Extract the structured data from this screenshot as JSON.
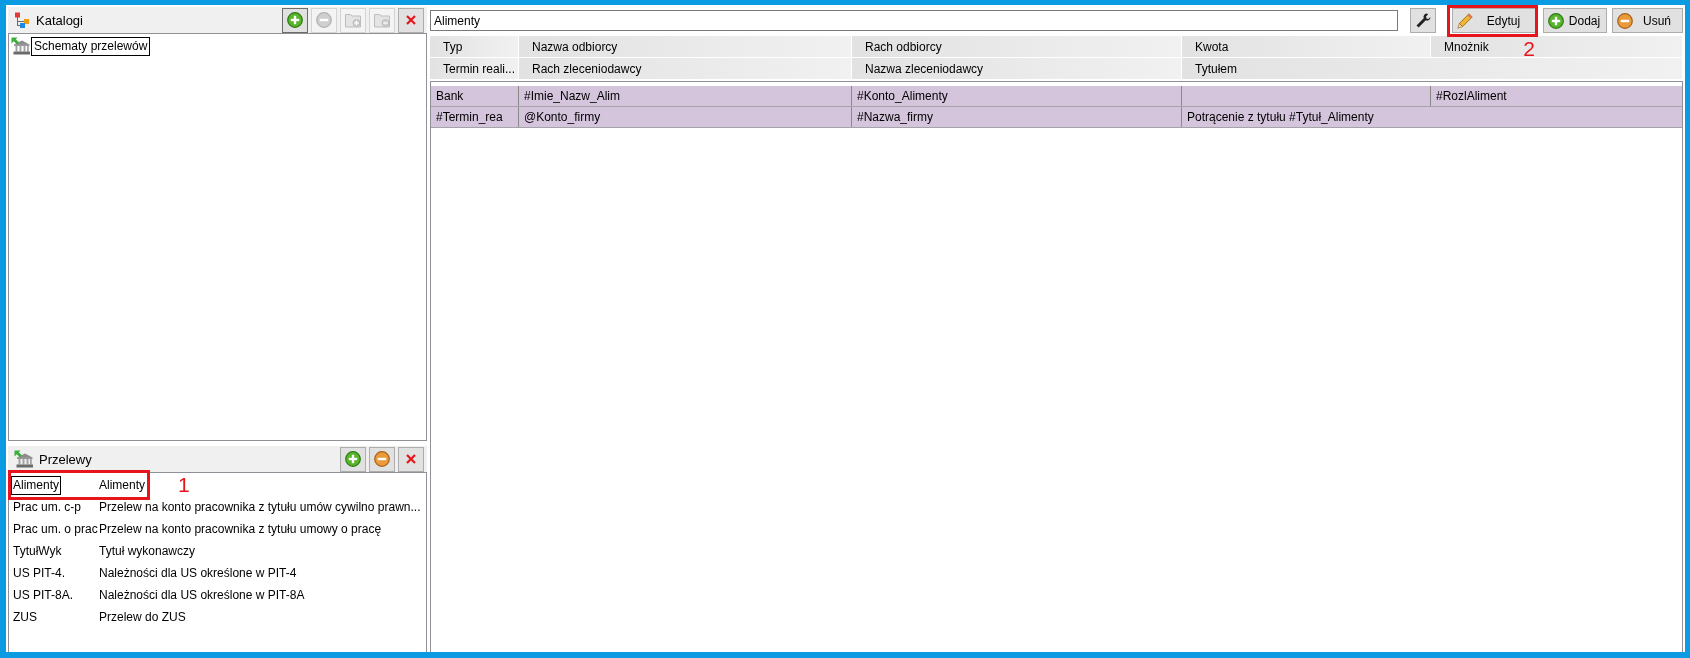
{
  "catalogs": {
    "title": "Katalogi",
    "toolbar": [
      {
        "kind": "add",
        "disabled": false,
        "focused": true
      },
      {
        "kind": "remove",
        "disabled": true,
        "focused": false
      },
      {
        "kind": "add-folder",
        "disabled": true,
        "focused": false
      },
      {
        "kind": "remove-folder",
        "disabled": true,
        "focused": false
      },
      {
        "kind": "close",
        "disabled": false,
        "focused": false
      }
    ],
    "tree": [
      {
        "label": "Schematy przelewów",
        "selected": true
      }
    ]
  },
  "transfers": {
    "title": "Przelewy",
    "toolbar": [
      {
        "kind": "add",
        "disabled": false,
        "focused": false
      },
      {
        "kind": "remove",
        "disabled": false,
        "focused": false
      },
      {
        "kind": "close",
        "disabled": false,
        "focused": false
      }
    ],
    "rows": [
      {
        "code": "Alimenty",
        "description": "Alimenty",
        "selected": true,
        "annotation": "1"
      },
      {
        "code": "Prac um. c-p",
        "description": "Przelew na konto pracownika z tytułu umów cywilno prawn...",
        "selected": false
      },
      {
        "code": "Prac um. o prac",
        "description": "Przelew na konto pracownika z tytułu umowy o pracę",
        "selected": false
      },
      {
        "code": "TytułWyk",
        "description": "Tytuł wykonawczy",
        "selected": false
      },
      {
        "code": "US PIT-4.",
        "description": "Należności dla US określone w PIT-4",
        "selected": false
      },
      {
        "code": "US PIT-8A.",
        "description": "Należności dla US określone w PIT-8A",
        "selected": false
      },
      {
        "code": "ZUS",
        "description": "Przelew do ZUS",
        "selected": false
      }
    ]
  },
  "schema": {
    "name_field": {
      "value": "Alimenty"
    },
    "toolbar": [
      {
        "kind": "settings"
      },
      {
        "kind": "edit",
        "label": "Edytuj",
        "annotation": "2"
      },
      {
        "kind": "add",
        "label": "Dodaj"
      },
      {
        "kind": "remove",
        "label": "Usuń"
      }
    ],
    "header_rows": [
      {
        "cells": [
          "Typ",
          "Nazwa odbiorcy",
          "Rach odbiorcy",
          "Kwota",
          "Mnożnik"
        ]
      },
      {
        "cells": [
          "Termin reali...",
          "Rach zleceniodawcy",
          "Nazwa zleceniodawcy",
          "Tytułem"
        ]
      }
    ],
    "rows": [
      {
        "selected": true,
        "cells": [
          "Bank",
          "#Imie_Nazw_Alim",
          "#Konto_Alimenty",
          null,
          "#RozlAliment"
        ]
      },
      {
        "selected": true,
        "cells": [
          "#Termin_rea",
          "@Konto_firmy",
          "#Nazwa_firmy",
          "Potrącenie z tytułu #Tytuł_Alimenty"
        ]
      }
    ]
  }
}
